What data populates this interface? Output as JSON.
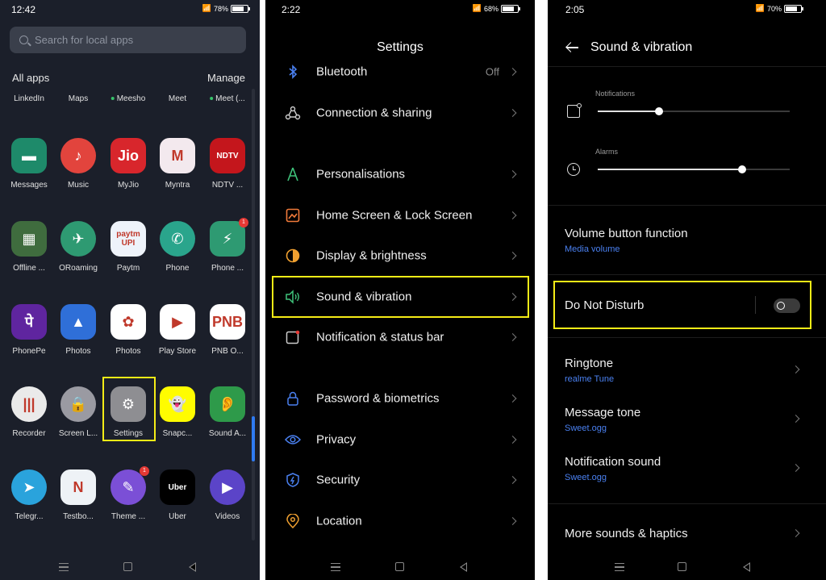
{
  "panel1": {
    "status": {
      "time": "12:42",
      "battery": "78%"
    },
    "search_placeholder": "Search for local apps",
    "all_apps": "All apps",
    "manage": "Manage",
    "top_row": [
      "LinkedIn",
      "Maps",
      "Meesho",
      "Meet",
      "Meet (..."
    ],
    "rows": [
      [
        {
          "label": "Messages",
          "color": "#1e8a6a",
          "glyph": "▬"
        },
        {
          "label": "Music",
          "color": "#e2443d",
          "glyph": "♪"
        },
        {
          "label": "MyJio",
          "color": "#d8262c",
          "glyph": "Jio"
        },
        {
          "label": "Myntra",
          "color": "#f3e9ee",
          "glyph": "M"
        },
        {
          "label": "NDTV ...",
          "color": "#c4161c",
          "glyph": "NDTV"
        }
      ],
      [
        {
          "label": "Offline ...",
          "color": "#3f6c3e",
          "glyph": "▦"
        },
        {
          "label": "ORoaming",
          "color": "#2e9a72",
          "glyph": "✈"
        },
        {
          "label": "Paytm",
          "color": "#eef3fa",
          "glyph": "paytm UPI"
        },
        {
          "label": "Phone",
          "color": "#2aa58c",
          "glyph": "✆"
        },
        {
          "label": "Phone ...",
          "color": "#2e9a72",
          "glyph": "⚡",
          "badge": "1"
        }
      ],
      [
        {
          "label": "PhonePe",
          "color": "#5f259f",
          "glyph": "पे"
        },
        {
          "label": "Photos",
          "color": "#2f6fd8",
          "glyph": "▲"
        },
        {
          "label": "Photos",
          "color": "#ffffff",
          "glyph": "✿"
        },
        {
          "label": "Play Store",
          "color": "#ffffff",
          "glyph": "▶"
        },
        {
          "label": "PNB O...",
          "color": "#ffffff",
          "glyph": "PNB"
        }
      ],
      [
        {
          "label": "Recorder",
          "color": "#eaeaea",
          "glyph": "|||"
        },
        {
          "label": "Screen L...",
          "color": "#9a9aa2",
          "glyph": "🔒"
        },
        {
          "label": "Settings",
          "color": "#8e8e92",
          "glyph": "⚙"
        },
        {
          "label": "Snapc...",
          "color": "#fffc00",
          "glyph": "👻"
        },
        {
          "label": "Sound A...",
          "color": "#2e9a4a",
          "glyph": "👂"
        }
      ],
      [
        {
          "label": "Telegr...",
          "color": "#2aa3dc",
          "glyph": "➤"
        },
        {
          "label": "Testbo...",
          "color": "#eef2f6",
          "glyph": "N"
        },
        {
          "label": "Theme ...",
          "color": "#7b4fd6",
          "glyph": "✎",
          "badge": "1"
        },
        {
          "label": "Uber",
          "color": "#000000",
          "glyph": "Uber"
        },
        {
          "label": "Videos",
          "color": "#5b44c8",
          "glyph": "▶"
        }
      ]
    ]
  },
  "panel2": {
    "status": {
      "time": "2:22",
      "battery": "68%"
    },
    "title": "Settings",
    "items": [
      {
        "label": "Bluetooth",
        "value": "Off",
        "icon": "bluetooth-icon"
      },
      {
        "label": "Connection & sharing",
        "icon": "connection-icon"
      },
      {
        "label": "Personalisations",
        "icon": "personalisation-icon"
      },
      {
        "label": "Home Screen & Lock Screen",
        "icon": "homescreen-icon"
      },
      {
        "label": "Display & brightness",
        "icon": "display-icon"
      },
      {
        "label": "Sound & vibration",
        "icon": "speaker-icon"
      },
      {
        "label": "Notification & status bar",
        "icon": "notification-icon"
      },
      {
        "label": "Password & biometrics",
        "icon": "lock-icon"
      },
      {
        "label": "Privacy",
        "icon": "eye-icon"
      },
      {
        "label": "Security",
        "icon": "shield-icon"
      },
      {
        "label": "Location",
        "icon": "location-pin-icon"
      }
    ]
  },
  "panel3": {
    "status": {
      "time": "2:05",
      "battery": "70%"
    },
    "title": "Sound & vibration",
    "sliders": [
      {
        "label": "Notifications",
        "level": 0.32
      },
      {
        "label": "Alarms",
        "level": 0.75
      }
    ],
    "items": [
      {
        "title": "Volume button function",
        "subtitle": "Media volume"
      },
      {
        "title": "Do Not Disturb"
      },
      {
        "title": "Ringtone",
        "subtitle": "realme Tune"
      },
      {
        "title": "Message tone",
        "subtitle": "Sweet.ogg"
      },
      {
        "title": "Notification sound",
        "subtitle": "Sweet.ogg"
      },
      {
        "title": "More sounds & haptics"
      }
    ],
    "dnd_enabled": false
  },
  "colors": {
    "highlight": "#f5ec16",
    "link": "#4a80f0",
    "accent": "#2f7bf2"
  }
}
